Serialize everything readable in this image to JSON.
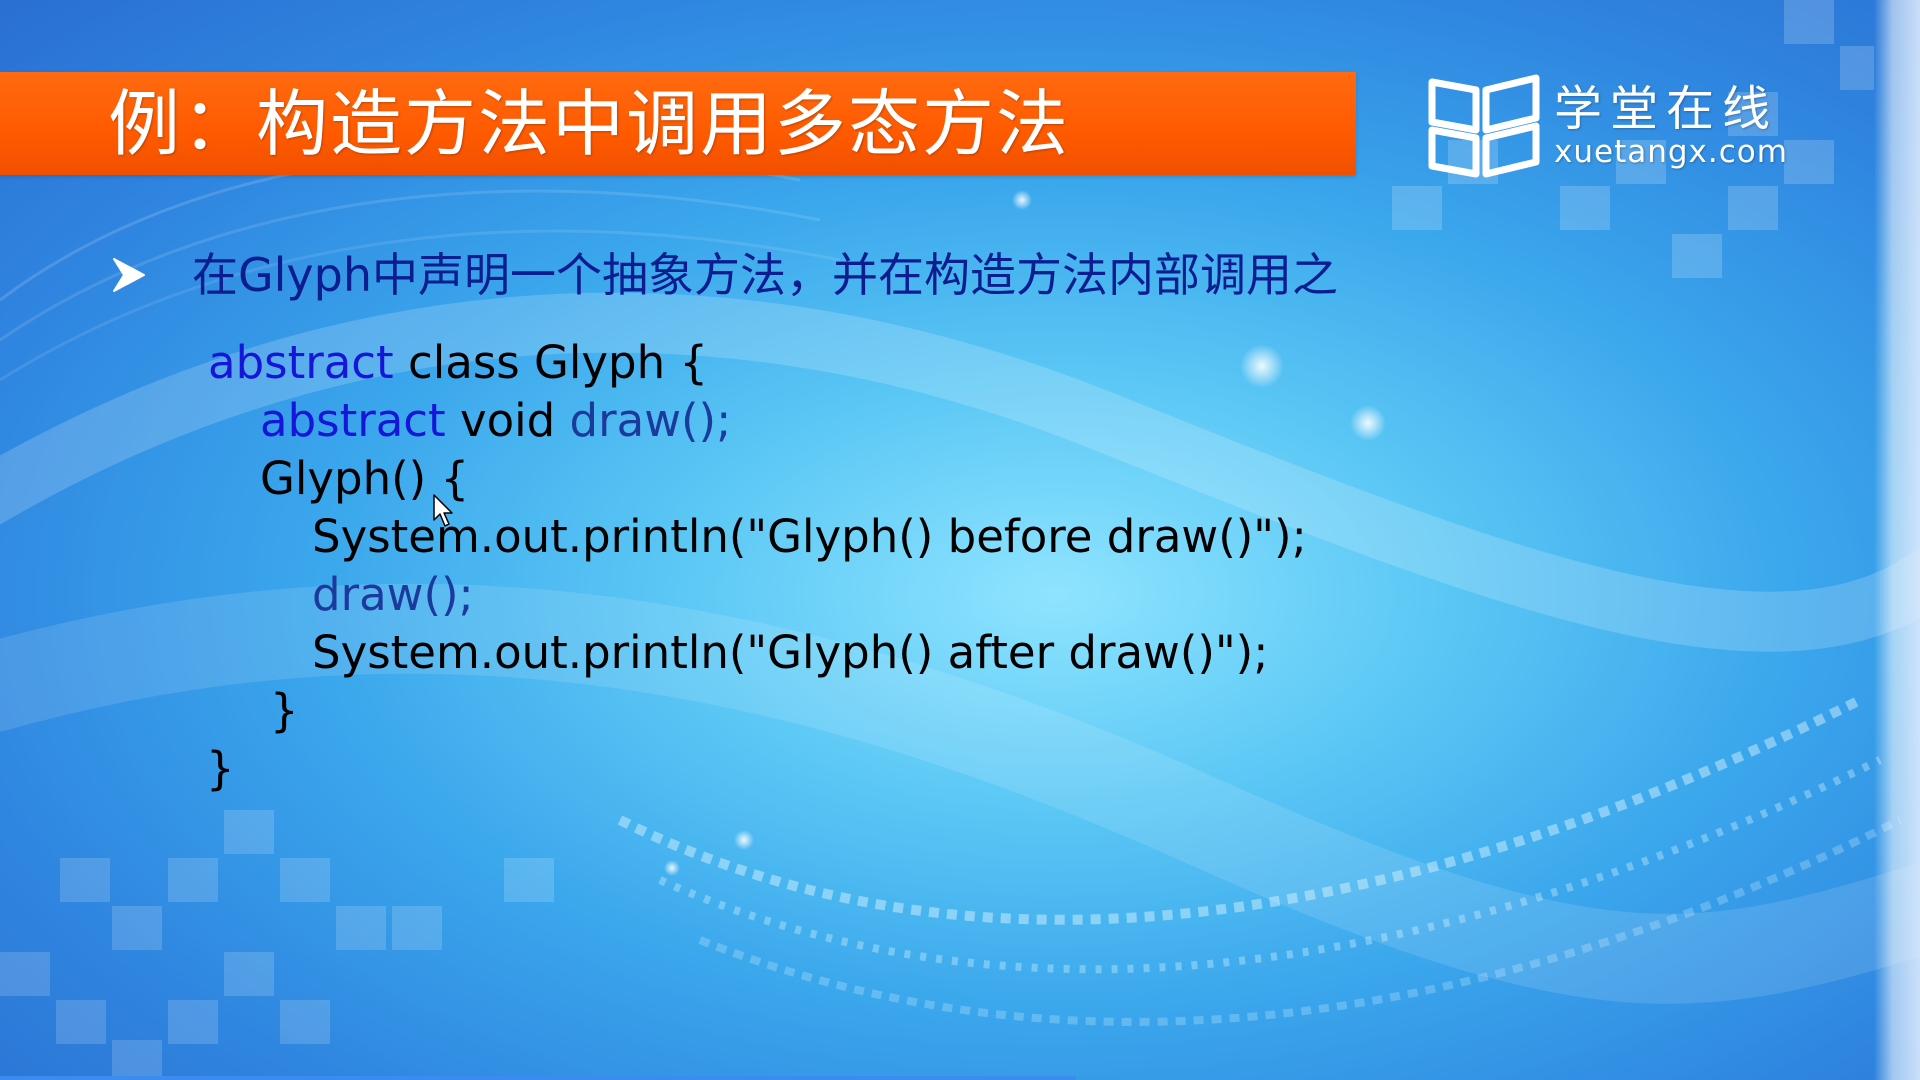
{
  "slide": {
    "title": "例：构造方法中调用多态方法",
    "bullet": "在Glyph中声明一个抽象方法，并在构造方法内部调用之"
  },
  "logo": {
    "icon": "xuetangx-book-logo-icon",
    "name_cn": "学堂在线",
    "name_en": "xuetangx.com"
  },
  "code": {
    "line1_kw": "abstract",
    "line1_rest": " class Glyph {",
    "line2_kw": "abstract",
    "line2_mid": " void ",
    "line2_call": "draw();",
    "line3": "Glyph() {",
    "line4": "System.out.println(\"Glyph() before draw()\");",
    "line5": "draw();",
    "line6": "System.out.println(\"Glyph() after draw()\");",
    "line7": "}",
    "line8": "}"
  },
  "colors": {
    "title_bar": "#ff5a00",
    "keyword": "#1616d8",
    "bullet_text": "#0b1d8f"
  }
}
